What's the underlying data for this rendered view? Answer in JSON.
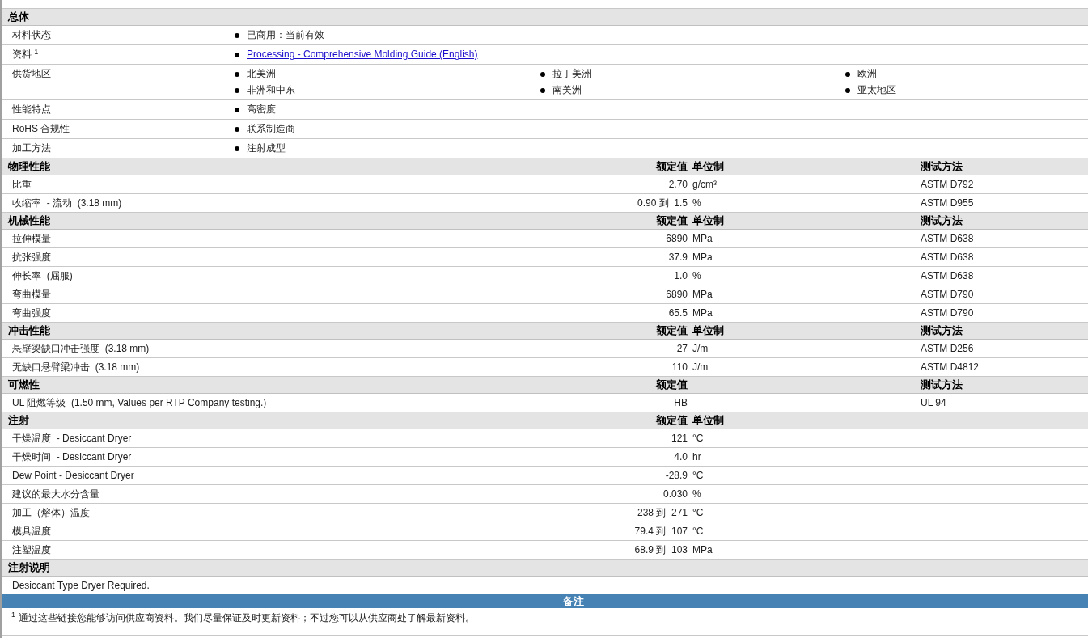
{
  "sections": [
    {
      "kind": "general",
      "title": "总体",
      "rows": [
        {
          "label": "材料状态",
          "items": [
            {
              "text": "已商用：当前有效",
              "link": false
            }
          ]
        },
        {
          "label": "资料 $^{1}$",
          "items": [
            {
              "text": "Processing - Comprehensive Molding Guide (English)",
              "link": true
            }
          ]
        },
        {
          "label": "供货地区",
          "items": [
            {
              "text": "北美洲",
              "link": false
            },
            {
              "text": "拉丁美洲",
              "link": false
            },
            {
              "text": "欧洲",
              "link": false
            },
            {
              "text": "非洲和中东",
              "link": false
            },
            {
              "text": "南美洲",
              "link": false
            },
            {
              "text": "亚太地区",
              "link": false
            }
          ]
        },
        {
          "label": "性能特点",
          "items": [
            {
              "text": "高密度",
              "link": false
            }
          ]
        },
        {
          "label": "RoHS 合规性",
          "items": [
            {
              "text": "联系制造商",
              "link": false
            }
          ]
        },
        {
          "label": "加工方法",
          "items": [
            {
              "text": "注射成型",
              "link": false
            }
          ]
        }
      ]
    },
    {
      "kind": "properties",
      "title": "物理性能",
      "value_header": "额定值",
      "unit_header": "单位制",
      "test_header": "测试方法",
      "rows": [
        {
          "label": "比重",
          "value": "2.70",
          "unit": "g/cm³",
          "test": "ASTM D792"
        },
        {
          "label": "收缩率  - 流动  (3.18 mm)",
          "value": "0.90 到  1.5",
          "unit": "%",
          "test": "ASTM D955"
        }
      ]
    },
    {
      "kind": "properties",
      "title": "机械性能",
      "value_header": "额定值",
      "unit_header": "单位制",
      "test_header": "测试方法",
      "rows": [
        {
          "label": "拉伸模量",
          "value": "6890",
          "unit": "MPa",
          "test": "ASTM D638"
        },
        {
          "label": "抗张强度",
          "value": "37.9",
          "unit": "MPa",
          "test": "ASTM D638"
        },
        {
          "label": "伸长率  (屈服)",
          "value": "1.0",
          "unit": "%",
          "test": "ASTM D638"
        },
        {
          "label": "弯曲模量",
          "value": "6890",
          "unit": "MPa",
          "test": "ASTM D790"
        },
        {
          "label": "弯曲强度",
          "value": "65.5",
          "unit": "MPa",
          "test": "ASTM D790"
        }
      ]
    },
    {
      "kind": "properties",
      "title": "冲击性能",
      "value_header": "额定值",
      "unit_header": "单位制",
      "test_header": "测试方法",
      "rows": [
        {
          "label": "悬壁梁缺口冲击强度  (3.18 mm)",
          "value": "27",
          "unit": "J/m",
          "test": "ASTM D256"
        },
        {
          "label": "无缺口悬臂梁冲击  (3.18 mm)",
          "value": "110",
          "unit": "J/m",
          "test": "ASTM D4812"
        }
      ]
    },
    {
      "kind": "properties",
      "title": "可燃性",
      "value_header": "额定值",
      "test_header": "测试方法",
      "rows": [
        {
          "label": "UL 阻燃等级  (1.50 mm, Values per RTP Company testing.)",
          "value": "HB",
          "test": "UL 94"
        }
      ]
    },
    {
      "kind": "properties",
      "title": "注射",
      "value_header": "额定值",
      "unit_header": "单位制",
      "rows": [
        {
          "label": "干燥温度  - Desiccant Dryer",
          "value": "121",
          "unit": "°C"
        },
        {
          "label": "干燥时间  - Desiccant Dryer",
          "value": "4.0",
          "unit": "hr"
        },
        {
          "label": "Dew Point - Desiccant Dryer",
          "value": "-28.9",
          "unit": "°C"
        },
        {
          "label": "建议的最大水分含量",
          "value": "0.030",
          "unit": "%"
        },
        {
          "label": "加工（熔体）温度",
          "value": "238 到  271",
          "unit": "°C"
        },
        {
          "label": "模具温度",
          "value": "79.4 到  107",
          "unit": "°C"
        },
        {
          "label": "注塑温度",
          "value": "68.9 到  103",
          "unit": "MPa"
        }
      ]
    },
    {
      "kind": "text",
      "title": "注射说明",
      "text": "Desiccant Type Dryer Required."
    }
  ],
  "notes": {
    "title": "备注",
    "footnotes": [
      {
        "mark": "1",
        "text": "通过这些链接您能够访问供应商资料。我们尽量保证及时更新资料；不过您可以从供应商处了解最新资料。"
      }
    ]
  }
}
